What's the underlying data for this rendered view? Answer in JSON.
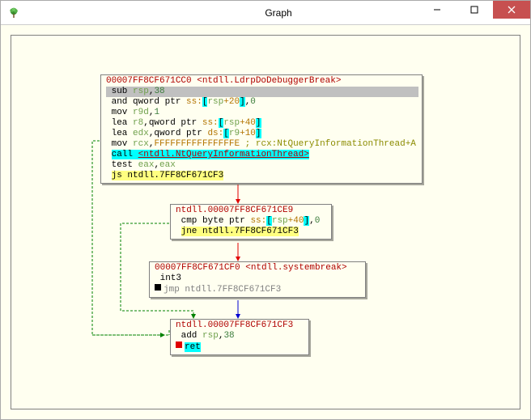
{
  "window": {
    "title": "Graph"
  },
  "node1": {
    "addr": "00007FF8CF671CC0 <ntdll.LdrpDoDebuggerBreak>",
    "l1_a": "sub ",
    "l1_r": "rsp",
    "l1_b": ",",
    "l1_n": "38",
    "l2_a": "and qword ptr ",
    "l2_s": "ss:",
    "l2_br1": "[",
    "l2_r": "rsp",
    "l2_p": "+",
    "l2_off": "20",
    "l2_br2": "]",
    "l2_c": ",",
    "l2_n": "0",
    "l3_a": "mov ",
    "l3_r": "r9d",
    "l3_c": ",",
    "l3_n": "1",
    "l4_a": "lea ",
    "l4_r1": "r8",
    "l4_c1": ",qword ptr ",
    "l4_s": "ss:",
    "l4_br1": "[",
    "l4_r2": "rsp",
    "l4_p": "+",
    "l4_off": "40",
    "l4_br2": "]",
    "l5_a": "lea ",
    "l5_r1": "edx",
    "l5_c1": ",qword ptr ",
    "l5_s": "ds:",
    "l5_br1": "[",
    "l5_r2": "r9",
    "l5_p": "+",
    "l5_off": "10",
    "l5_br2": "]",
    "l6_a": "mov ",
    "l6_r": "rcx",
    "l6_c": ",",
    "l6_hex": "FFFFFFFFFFFFFFFE",
    "l6_cm": " ; rcx:NtQueryInformationThread+A",
    "l7_call": "call ",
    "l7_t": "<ntdll.NtQueryInformationThread>",
    "l8_a": "test ",
    "l8_r1": "eax",
    "l8_c": ",",
    "l8_r2": "eax",
    "l9_jmp": "js ",
    "l9_t": "ntdll.7FF8CF671CF3"
  },
  "node2": {
    "addr": "ntdll.00007FF8CF671CE9",
    "l1_a": "cmp byte ptr ",
    "l1_s": "ss:",
    "l1_br1": "[",
    "l1_r": "rsp",
    "l1_p": "+",
    "l1_off": "40",
    "l1_br2": "]",
    "l1_c": ",",
    "l1_n": "0",
    "l2_jmp": "jne ",
    "l2_t": "ntdll.7FF8CF671CF3"
  },
  "node3": {
    "addr": "00007FF8CF671CF0 <ntdll.systembreak>",
    "l1": "int3",
    "l2_a": "jmp ",
    "l2_t": "ntdll.7FF8CF671CF3"
  },
  "node4": {
    "addr": "ntdll.00007FF8CF671CF3",
    "l1_a": "add ",
    "l1_r": "rsp",
    "l1_c": ",",
    "l1_n": "38",
    "l2": "ret"
  },
  "chart_data": {
    "type": "diagram",
    "nodes": [
      {
        "id": "n1",
        "address": "00007FF8CF671CC0",
        "label": "ntdll.LdrpDoDebuggerBreak",
        "instructions": [
          "sub rsp,38",
          "and qword ptr ss:[rsp+20],0",
          "mov r9d,1",
          "lea r8,qword ptr ss:[rsp+40]",
          "lea edx,qword ptr ds:[r9+10]",
          "mov rcx,FFFFFFFFFFFFFFFE",
          "call <ntdll.NtQueryInformationThread>",
          "test eax,eax",
          "js ntdll.7FF8CF671CF3"
        ]
      },
      {
        "id": "n2",
        "address": "00007FF8CF671CE9",
        "label": "ntdll.00007FF8CF671CE9",
        "instructions": [
          "cmp byte ptr ss:[rsp+40],0",
          "jne ntdll.7FF8CF671CF3"
        ]
      },
      {
        "id": "n3",
        "address": "00007FF8CF671CF0",
        "label": "ntdll.systembreak",
        "instructions": [
          "int3",
          "jmp ntdll.7FF8CF671CF3"
        ]
      },
      {
        "id": "n4",
        "address": "00007FF8CF671CF3",
        "label": "ntdll.00007FF8CF671CF3",
        "instructions": [
          "add rsp,38",
          "ret"
        ]
      }
    ],
    "edges": [
      {
        "from": "n1",
        "to": "n2",
        "kind": "fallthrough",
        "color": "red"
      },
      {
        "from": "n1",
        "to": "n4",
        "kind": "branch-taken",
        "color": "green"
      },
      {
        "from": "n2",
        "to": "n3",
        "kind": "fallthrough",
        "color": "red"
      },
      {
        "from": "n2",
        "to": "n4",
        "kind": "branch-taken",
        "color": "green"
      },
      {
        "from": "n3",
        "to": "n4",
        "kind": "unconditional",
        "color": "blue"
      }
    ]
  }
}
